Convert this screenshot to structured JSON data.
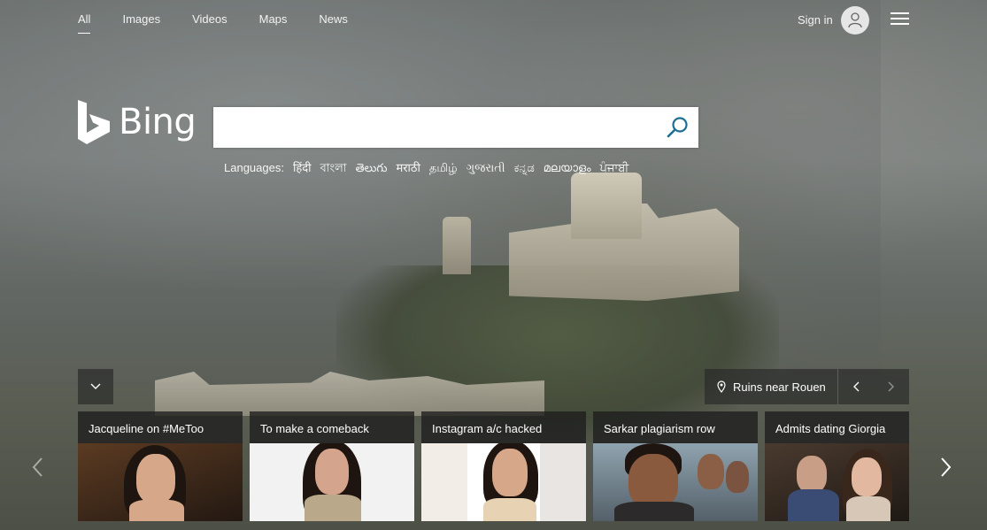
{
  "nav": {
    "tabs": [
      {
        "label": "All",
        "active": true
      },
      {
        "label": "Images"
      },
      {
        "label": "Videos"
      },
      {
        "label": "Maps"
      },
      {
        "label": "News"
      }
    ],
    "signin_label": "Sign in"
  },
  "logo": {
    "text": "Bing"
  },
  "search": {
    "value": "",
    "placeholder": ""
  },
  "languages": {
    "label": "Languages:",
    "items": [
      "हिंदी",
      "বাংলা",
      "తెలుగు",
      "मराठी",
      "தமிழ்",
      "ગુજરાતી",
      "ಕನ್ನಡ",
      "മലയാളം",
      "ਪੰਜਾਬੀ"
    ]
  },
  "image_info": {
    "location": "Ruins near Rouen"
  },
  "news": [
    {
      "title": "Jacqueline on #MeToo",
      "bg": "#3a2a22"
    },
    {
      "title": "To make a comeback",
      "bg": "#f1f1f1"
    },
    {
      "title": "Instagram a/c hacked",
      "bg": "#efe9e4"
    },
    {
      "title": "Sarkar plagiarism row",
      "bg": "#6e7d88"
    },
    {
      "title": "Admits dating Giorgia",
      "bg": "#2b2420"
    }
  ],
  "colors": {
    "accent": "#008373",
    "search_icon": "#1d6f96"
  }
}
